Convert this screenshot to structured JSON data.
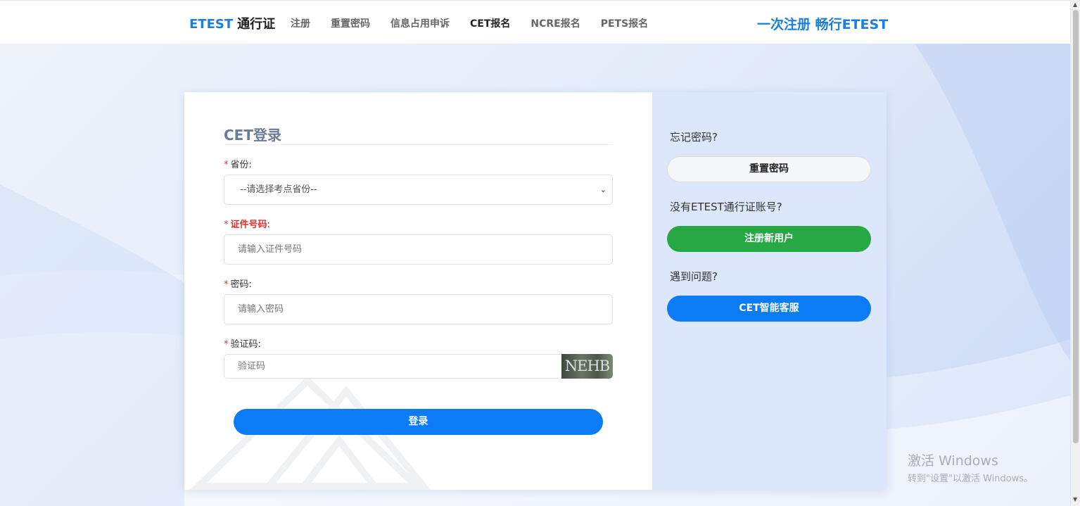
{
  "header": {
    "brand_primary": "ETEST",
    "brand_secondary": "通行证",
    "nav": [
      "注册",
      "重置密码",
      "信息占用申诉",
      "CET报名",
      "NCRE报名",
      "PETS报名"
    ],
    "active_nav": "CET报名",
    "slogan": "一次注册 畅行ETEST"
  },
  "login": {
    "title": "CET登录",
    "required_mark": "*",
    "province_label": "省份:",
    "province_selected": "--请选择考点省份--",
    "id_label": "证件号码",
    "id_label_suffix": ":",
    "id_placeholder": "请输入证件号码",
    "password_label": "密码:",
    "password_placeholder": "请输入密码",
    "captcha_label": "验证码:",
    "captcha_placeholder": "验证码",
    "captcha_text": "NEHB",
    "submit_label": "登录"
  },
  "sidebar": {
    "forgot_text": "忘记密码?",
    "reset_button": "重置密码",
    "no_account_text": "没有ETEST通行证账号?",
    "register_button": "注册新用户",
    "problem_text": "遇到问题?",
    "service_button": "CET智能客服"
  },
  "watermark": {
    "line1": "激活 Windows",
    "line2": "转到\"设置\"以激活 Windows。"
  },
  "colors": {
    "brand_blue": "#1a7fe0",
    "primary_button": "#0b7cf5",
    "register_green": "#28a745",
    "required_red": "#e0332d",
    "sidebar_bg": "#dde7fb"
  }
}
